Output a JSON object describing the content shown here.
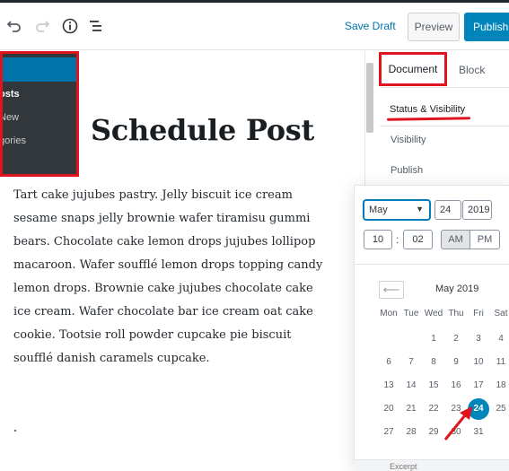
{
  "toolbar": {
    "save_draft": "Save Draft",
    "preview": "Preview",
    "publish": "Publish..."
  },
  "admin_menu": {
    "items": [
      "osts",
      "New",
      "gories"
    ]
  },
  "post": {
    "title": "Schedule Post",
    "body_lines": [
      "Tart cake jujubes pastry. Jelly biscuit ice cream",
      "sesame snaps jelly brownie wafer tiramisu gummi",
      "bears. Chocolate cake lemon drops jujubes lollipop",
      "macaroon. Wafer soufflé lemon drops topping candy",
      "lemon drops. Brownie cake jujubes chocolate cake",
      "ice cream. Wafer chocolate bar ice cream oat cake",
      "cookie. Tootsie roll powder cupcake pie biscuit",
      "soufflé danish caramels cupcake."
    ]
  },
  "sidebar": {
    "tab_document": "Document",
    "tab_block": "Block",
    "section_title": "Status & Visibility",
    "visibility_label": "Visibility",
    "publish_label": "Publish",
    "bottom_text": "Excerpt"
  },
  "datepicker": {
    "month_select": "May",
    "day_value": "24",
    "year_value": "2019",
    "hour_value": "10",
    "minute_value": "02",
    "am": "AM",
    "pm": "PM",
    "calendar_title": "May 2019",
    "weekdays": [
      "Mon",
      "Tue",
      "Wed",
      "Thu",
      "Fri",
      "Sat"
    ],
    "weeks": [
      [
        "",
        "",
        "1",
        "2",
        "3",
        "4"
      ],
      [
        "6",
        "7",
        "8",
        "9",
        "10",
        "11"
      ],
      [
        "13",
        "14",
        "15",
        "16",
        "17",
        "18"
      ],
      [
        "20",
        "21",
        "22",
        "23",
        "24",
        "25"
      ],
      [
        "27",
        "28",
        "29",
        "30",
        "31",
        ""
      ]
    ],
    "selected_day": "24"
  },
  "colors": {
    "accent_blue": "#0085ba",
    "link_blue": "#0073aa",
    "annotation_red": "#e0141e",
    "admin_dark": "#32373c"
  }
}
